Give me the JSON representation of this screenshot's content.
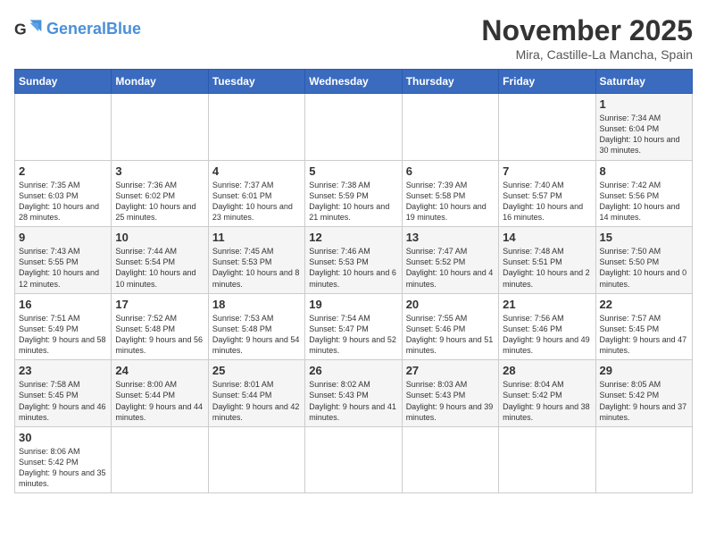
{
  "header": {
    "logo_general": "General",
    "logo_blue": "Blue",
    "month_title": "November 2025",
    "location": "Mira, Castille-La Mancha, Spain"
  },
  "days_of_week": [
    "Sunday",
    "Monday",
    "Tuesday",
    "Wednesday",
    "Thursday",
    "Friday",
    "Saturday"
  ],
  "weeks": [
    [
      {
        "day": "",
        "info": ""
      },
      {
        "day": "",
        "info": ""
      },
      {
        "day": "",
        "info": ""
      },
      {
        "day": "",
        "info": ""
      },
      {
        "day": "",
        "info": ""
      },
      {
        "day": "",
        "info": ""
      },
      {
        "day": "1",
        "info": "Sunrise: 7:34 AM\nSunset: 6:04 PM\nDaylight: 10 hours and 30 minutes."
      }
    ],
    [
      {
        "day": "2",
        "info": "Sunrise: 7:35 AM\nSunset: 6:03 PM\nDaylight: 10 hours and 28 minutes."
      },
      {
        "day": "3",
        "info": "Sunrise: 7:36 AM\nSunset: 6:02 PM\nDaylight: 10 hours and 25 minutes."
      },
      {
        "day": "4",
        "info": "Sunrise: 7:37 AM\nSunset: 6:01 PM\nDaylight: 10 hours and 23 minutes."
      },
      {
        "day": "5",
        "info": "Sunrise: 7:38 AM\nSunset: 5:59 PM\nDaylight: 10 hours and 21 minutes."
      },
      {
        "day": "6",
        "info": "Sunrise: 7:39 AM\nSunset: 5:58 PM\nDaylight: 10 hours and 19 minutes."
      },
      {
        "day": "7",
        "info": "Sunrise: 7:40 AM\nSunset: 5:57 PM\nDaylight: 10 hours and 16 minutes."
      },
      {
        "day": "8",
        "info": "Sunrise: 7:42 AM\nSunset: 5:56 PM\nDaylight: 10 hours and 14 minutes."
      }
    ],
    [
      {
        "day": "9",
        "info": "Sunrise: 7:43 AM\nSunset: 5:55 PM\nDaylight: 10 hours and 12 minutes."
      },
      {
        "day": "10",
        "info": "Sunrise: 7:44 AM\nSunset: 5:54 PM\nDaylight: 10 hours and 10 minutes."
      },
      {
        "day": "11",
        "info": "Sunrise: 7:45 AM\nSunset: 5:53 PM\nDaylight: 10 hours and 8 minutes."
      },
      {
        "day": "12",
        "info": "Sunrise: 7:46 AM\nSunset: 5:53 PM\nDaylight: 10 hours and 6 minutes."
      },
      {
        "day": "13",
        "info": "Sunrise: 7:47 AM\nSunset: 5:52 PM\nDaylight: 10 hours and 4 minutes."
      },
      {
        "day": "14",
        "info": "Sunrise: 7:48 AM\nSunset: 5:51 PM\nDaylight: 10 hours and 2 minutes."
      },
      {
        "day": "15",
        "info": "Sunrise: 7:50 AM\nSunset: 5:50 PM\nDaylight: 10 hours and 0 minutes."
      }
    ],
    [
      {
        "day": "16",
        "info": "Sunrise: 7:51 AM\nSunset: 5:49 PM\nDaylight: 9 hours and 58 minutes."
      },
      {
        "day": "17",
        "info": "Sunrise: 7:52 AM\nSunset: 5:48 PM\nDaylight: 9 hours and 56 minutes."
      },
      {
        "day": "18",
        "info": "Sunrise: 7:53 AM\nSunset: 5:48 PM\nDaylight: 9 hours and 54 minutes."
      },
      {
        "day": "19",
        "info": "Sunrise: 7:54 AM\nSunset: 5:47 PM\nDaylight: 9 hours and 52 minutes."
      },
      {
        "day": "20",
        "info": "Sunrise: 7:55 AM\nSunset: 5:46 PM\nDaylight: 9 hours and 51 minutes."
      },
      {
        "day": "21",
        "info": "Sunrise: 7:56 AM\nSunset: 5:46 PM\nDaylight: 9 hours and 49 minutes."
      },
      {
        "day": "22",
        "info": "Sunrise: 7:57 AM\nSunset: 5:45 PM\nDaylight: 9 hours and 47 minutes."
      }
    ],
    [
      {
        "day": "23",
        "info": "Sunrise: 7:58 AM\nSunset: 5:45 PM\nDaylight: 9 hours and 46 minutes."
      },
      {
        "day": "24",
        "info": "Sunrise: 8:00 AM\nSunset: 5:44 PM\nDaylight: 9 hours and 44 minutes."
      },
      {
        "day": "25",
        "info": "Sunrise: 8:01 AM\nSunset: 5:44 PM\nDaylight: 9 hours and 42 minutes."
      },
      {
        "day": "26",
        "info": "Sunrise: 8:02 AM\nSunset: 5:43 PM\nDaylight: 9 hours and 41 minutes."
      },
      {
        "day": "27",
        "info": "Sunrise: 8:03 AM\nSunset: 5:43 PM\nDaylight: 9 hours and 39 minutes."
      },
      {
        "day": "28",
        "info": "Sunrise: 8:04 AM\nSunset: 5:42 PM\nDaylight: 9 hours and 38 minutes."
      },
      {
        "day": "29",
        "info": "Sunrise: 8:05 AM\nSunset: 5:42 PM\nDaylight: 9 hours and 37 minutes."
      }
    ],
    [
      {
        "day": "30",
        "info": "Sunrise: 8:06 AM\nSunset: 5:42 PM\nDaylight: 9 hours and 35 minutes."
      },
      {
        "day": "",
        "info": ""
      },
      {
        "day": "",
        "info": ""
      },
      {
        "day": "",
        "info": ""
      },
      {
        "day": "",
        "info": ""
      },
      {
        "day": "",
        "info": ""
      },
      {
        "day": "",
        "info": ""
      }
    ]
  ]
}
